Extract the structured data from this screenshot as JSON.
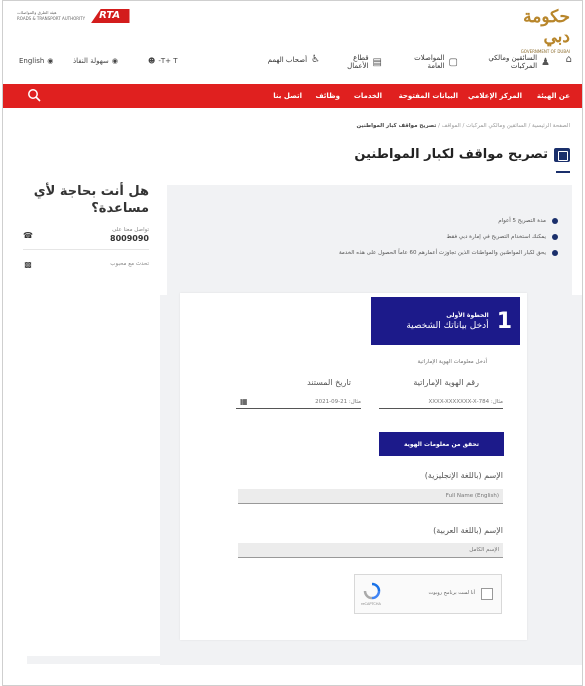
{
  "header": {
    "gov_logo_ar": "حكومة دبي",
    "gov_logo_en": "GOVERNMENT OF DUBAI",
    "rta_lines": [
      "هيئة الطرق والمواصلات",
      "ROADS & TRANSPORT AUTHORITY"
    ],
    "rta_mark": "RTA"
  },
  "nav": {
    "home_icon": "home-icon",
    "items": [
      {
        "label": "السائقين ومالكي المركبات",
        "icon": "driver-icon"
      },
      {
        "label": "المواصلات العامة",
        "icon": "bus-icon"
      },
      {
        "label": "قطاع الأعمال",
        "icon": "business-icon"
      },
      {
        "label": "أصحاب الهمم",
        "icon": "accessibility-icon"
      }
    ],
    "utility": {
      "lang": "English",
      "accessibility": "سهولة النفاذ",
      "font": "T+ T-"
    }
  },
  "menu": {
    "items": [
      "عن الهيئة",
      "المركز الإعلامي",
      "البيانات المفتوحة",
      "الخدمات",
      "وظائف",
      "اتصل بنا"
    ]
  },
  "breadcrumb": {
    "path": "الصفحة الرئيسية / السائقين ومالكي المركبات / المواقف / ",
    "current": "تصريح مواقف كبار المواطنين"
  },
  "page_title": "تصريح مواقف لكبار المواطنين",
  "help": {
    "title": "هل أنت بحاجة لأي مساعدة؟",
    "phone_label": "تواصل معنا على",
    "phone_number": "8009090",
    "chat_label": "تحدث مع محبوب"
  },
  "info": {
    "items": [
      "مدة التصريح 5 أعوام",
      "يمكنك استخدام التصريح في إمارة دبي فقط",
      "يحق لكبار المواطنين والمواطنات الذين تجاوزت أعمارهم 60 عاماً الحصول على هذه الخدمة"
    ]
  },
  "form": {
    "step_number": "1",
    "step_title": "الخطوة الأولى",
    "step_subtitle": "أدخل بياناتك الشخصية",
    "section_hint": "أدخل معلومات الهوية الإماراتية",
    "eid_label": "رقم الهوية الإماراتية",
    "eid_placeholder": "مثال: 784-XXXX-XXXXXXX-X",
    "doc_date_label": "تاريخ المستند",
    "doc_date_placeholder": "مثال: 21-09-2021",
    "verify_button": "تحقق من معلومات الهوية",
    "name_en_label": "الإسم (باللغة الإنجليزية)",
    "name_en_placeholder": "Full Name (English)",
    "name_ar_label": "الإسم (باللغة العربية)",
    "name_ar_placeholder": "الإسم الكامل",
    "captcha_text": "أنا لست برنامج روبوت",
    "captcha_brand": "reCAPTCHA"
  },
  "colors": {
    "red": "#e0201f",
    "navy": "#1c1a8a",
    "panel": "#f1f2f4"
  }
}
